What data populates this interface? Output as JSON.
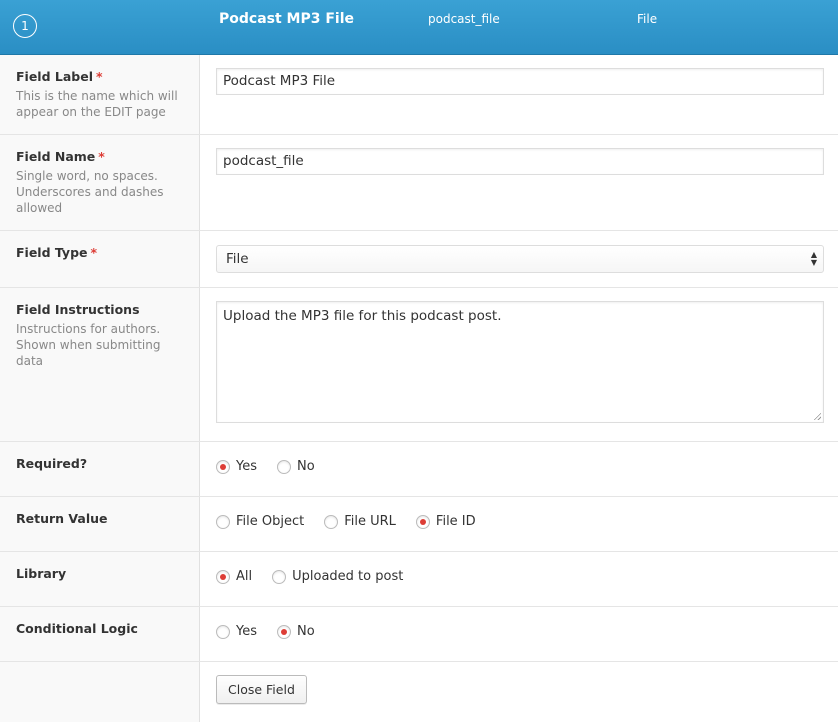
{
  "header": {
    "order": "1",
    "label": "Podcast MP3 File",
    "name": "podcast_file",
    "type": "File"
  },
  "required_marker": "*",
  "fields": {
    "label": {
      "title": "Field Label",
      "desc": "This is the name which will appear on the EDIT page",
      "value": "Podcast MP3 File"
    },
    "name": {
      "title": "Field Name",
      "desc": "Single word, no spaces. Underscores and dashes allowed",
      "value": "podcast_file"
    },
    "type": {
      "title": "Field Type",
      "value": "File"
    },
    "instructions": {
      "title": "Field Instructions",
      "desc": "Instructions for authors. Shown when submitting data",
      "value": "Upload the MP3 file for this podcast post."
    },
    "required": {
      "title": "Required?",
      "options": [
        "Yes",
        "No"
      ],
      "selected": "Yes"
    },
    "return_value": {
      "title": "Return Value",
      "options": [
        "File Object",
        "File URL",
        "File ID"
      ],
      "selected": "File ID"
    },
    "library": {
      "title": "Library",
      "options": [
        "All",
        "Uploaded to post"
      ],
      "selected": "All"
    },
    "conditional_logic": {
      "title": "Conditional Logic",
      "options": [
        "Yes",
        "No"
      ],
      "selected": "No"
    }
  },
  "close_button": "Close Field",
  "colors": {
    "header": "#2e96cc",
    "required": "#dd3d36",
    "radio_checked": "#dd3d36"
  }
}
